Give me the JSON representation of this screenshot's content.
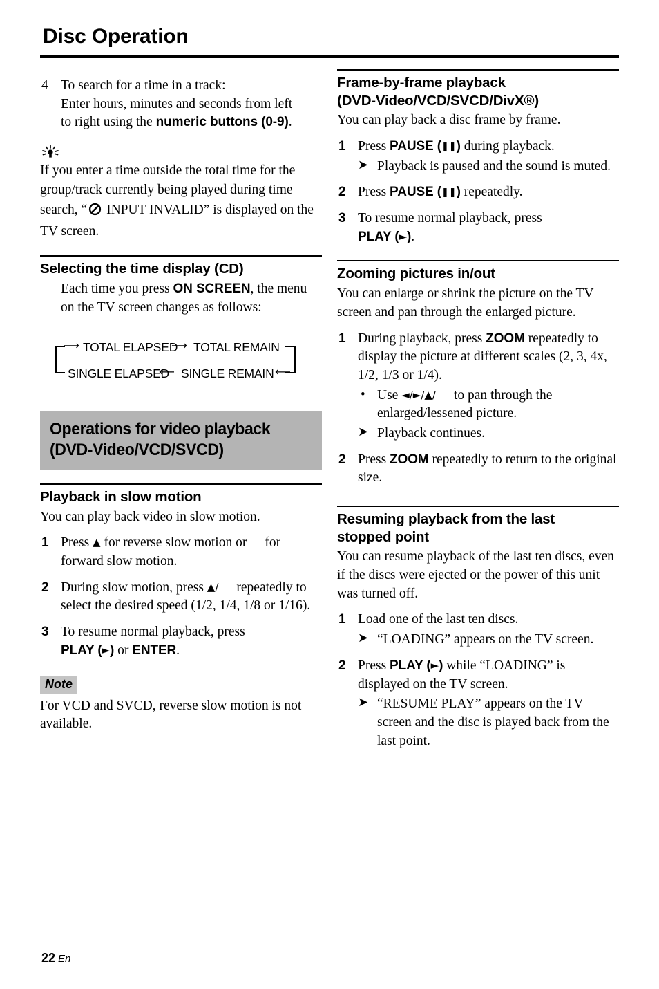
{
  "page": {
    "title": "Disc Operation",
    "footer_page_number": "22",
    "footer_language": "En"
  },
  "colors": {
    "banner_gray": "#b4b4b4",
    "note_gray": "#c4c4c4",
    "text": "#000000"
  },
  "left_column": {
    "step4": {
      "number": "4",
      "line1": "To search for a time in a track:",
      "line2": "Enter hours, minutes and seconds from left",
      "line3_pre": "to right using the ",
      "line3_bold": "numeric buttons (0-9)",
      "line3_post": "."
    },
    "tip": {
      "icon": "tip-bulb-icon",
      "text_part1": "If you enter a time outside the total time for the group/track currently being played during time search, “",
      "icon_inline": "no-entry-icon",
      "text_part2": " INPUT INVALID” is displayed on the TV screen."
    },
    "section_time_display": {
      "heading": "Selecting the time display (CD)",
      "body_pre": "Each time you press ",
      "body_bold": "ON SCREEN",
      "body_post": ", the menu on the TV screen changes as follows:"
    },
    "cycle_diagram": {
      "item1": "TOTAL ELAPSED",
      "item2": "TOTAL REMAIN",
      "item3": "SINGLE ELAPSED",
      "item4": "SINGLE REMAIN"
    },
    "banner": {
      "line1": "Operations for video playback",
      "line2": "(DVD-Video/VCD/SVCD)"
    },
    "section_slow_motion": {
      "heading": "Playback in slow motion",
      "intro": "You can play back video in slow motion.",
      "steps": [
        {
          "number": "1",
          "pre": "Press ",
          "glyph": "▲",
          "mid": " for reverse slow motion or",
          "post": "for forward slow motion."
        },
        {
          "number": "2",
          "pre": "During slow motion, press ",
          "glyph": "▲/",
          "mid": "repeatedly",
          "post": "to select the desired speed (1/2, 1/4, 1/8 or 1/16)."
        },
        {
          "number": "3",
          "pre": "To resume normal playback, press",
          "bold1": "PLAY (",
          "glyph": "►",
          "bold2": ")",
          "mid": " or ",
          "bold3": "ENTER",
          "post": "."
        }
      ],
      "note_label": "Note",
      "note_text": "For VCD and SVCD, reverse slow motion is not available."
    }
  },
  "right_column": {
    "section_frame_by_frame": {
      "heading_line1": "Frame-by-frame playback",
      "heading_line2": "(DVD-Video/VCD/SVCD/DivX®)",
      "intro": "You can play back a disc frame by frame.",
      "steps": [
        {
          "number": "1",
          "pre": "Press ",
          "bold1": "PAUSE (",
          "glyph": "❚❚",
          "bold2": ")",
          "post": " during playback.",
          "result": "Playback is paused and the sound is muted."
        },
        {
          "number": "2",
          "pre": "Press ",
          "bold1": "PAUSE (",
          "glyph": "❚❚",
          "bold2": ")",
          "post": " repeatedly."
        },
        {
          "number": "3",
          "pre": "To resume normal playback, press",
          "bold1": "PLAY (",
          "glyph": "►",
          "bold2": ")",
          "post": "."
        }
      ]
    },
    "section_zooming": {
      "heading": "Zooming pictures in/out",
      "intro": "You can enlarge or shrink the picture on the TV screen and pan through the enlarged picture.",
      "steps": [
        {
          "number": "1",
          "pre": "During playback, press ",
          "bold1": "ZOOM",
          "post": " repeatedly to display the picture at different scales (2, 3, 4x, 1/2, 1/3 or 1/4).",
          "bullet_pre": "Use ",
          "bullet_glyph": "◄/►/▲/",
          "bullet_post": "to pan through the enlarged/lessened picture.",
          "result": "Playback continues."
        },
        {
          "number": "2",
          "pre": "Press ",
          "bold1": "ZOOM",
          "post": " repeatedly to return to the original size."
        }
      ]
    },
    "section_resuming": {
      "heading_line1": "Resuming playback from the last",
      "heading_line2": "stopped point",
      "intro": "You can resume playback of the last ten discs, even if the discs were ejected or the power of this unit was turned off.",
      "steps": [
        {
          "number": "1",
          "text": "Load one of the last ten discs.",
          "result": "“LOADING” appears on the TV screen."
        },
        {
          "number": "2",
          "pre": "Press ",
          "bold1": "PLAY (",
          "glyph": "►",
          "bold2": ")",
          "post": " while “LOADING” is displayed on the TV screen.",
          "result": "“RESUME PLAY” appears on the TV screen and the disc is played back from the last point."
        }
      ]
    }
  }
}
